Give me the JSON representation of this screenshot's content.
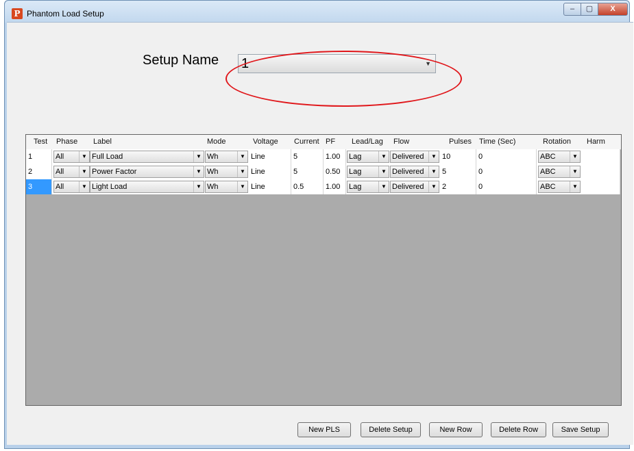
{
  "window": {
    "title": "Phantom Load Setup",
    "app_icon": "P",
    "minimize": "–",
    "maximize": "▢",
    "close": "X"
  },
  "setup": {
    "label": "Setup Name",
    "value": "1"
  },
  "grid": {
    "headers": [
      "Test",
      "Phase",
      "Label",
      "Mode",
      "Voltage",
      "Current",
      "PF",
      "Lead/Lag",
      "Flow",
      "Pulses",
      "Time (Sec)",
      "Rotation",
      "Harm"
    ],
    "rows": [
      {
        "test": "1",
        "phase": "All",
        "label": "Full Load",
        "mode": "Wh",
        "voltage": "Line",
        "current": "5",
        "pf": "1.00",
        "leadlag": "Lag",
        "flow": "Delivered",
        "pulses": "10",
        "time": "0",
        "rotation": "ABC",
        "harm": ""
      },
      {
        "test": "2",
        "phase": "All",
        "label": "Power Factor",
        "mode": "Wh",
        "voltage": "Line",
        "current": "5",
        "pf": "0.50",
        "leadlag": "Lag",
        "flow": "Delivered",
        "pulses": "5",
        "time": "0",
        "rotation": "ABC",
        "harm": ""
      },
      {
        "test": "3",
        "phase": "All",
        "label": "Light Load",
        "mode": "Wh",
        "voltage": "Line",
        "current": "0.5",
        "pf": "1.00",
        "leadlag": "Lag",
        "flow": "Delivered",
        "pulses": "2",
        "time": "0",
        "rotation": "ABC",
        "harm": ""
      }
    ]
  },
  "buttons": {
    "new_pls": "New PLS",
    "delete_setup": "Delete Setup",
    "new_row": "New Row",
    "delete_row": "Delete Row",
    "save_setup": "Save Setup"
  },
  "colors": {
    "highlight_ring": "#e0161a",
    "selected_cell": "#3399ff",
    "grid_empty": "#ababab"
  }
}
